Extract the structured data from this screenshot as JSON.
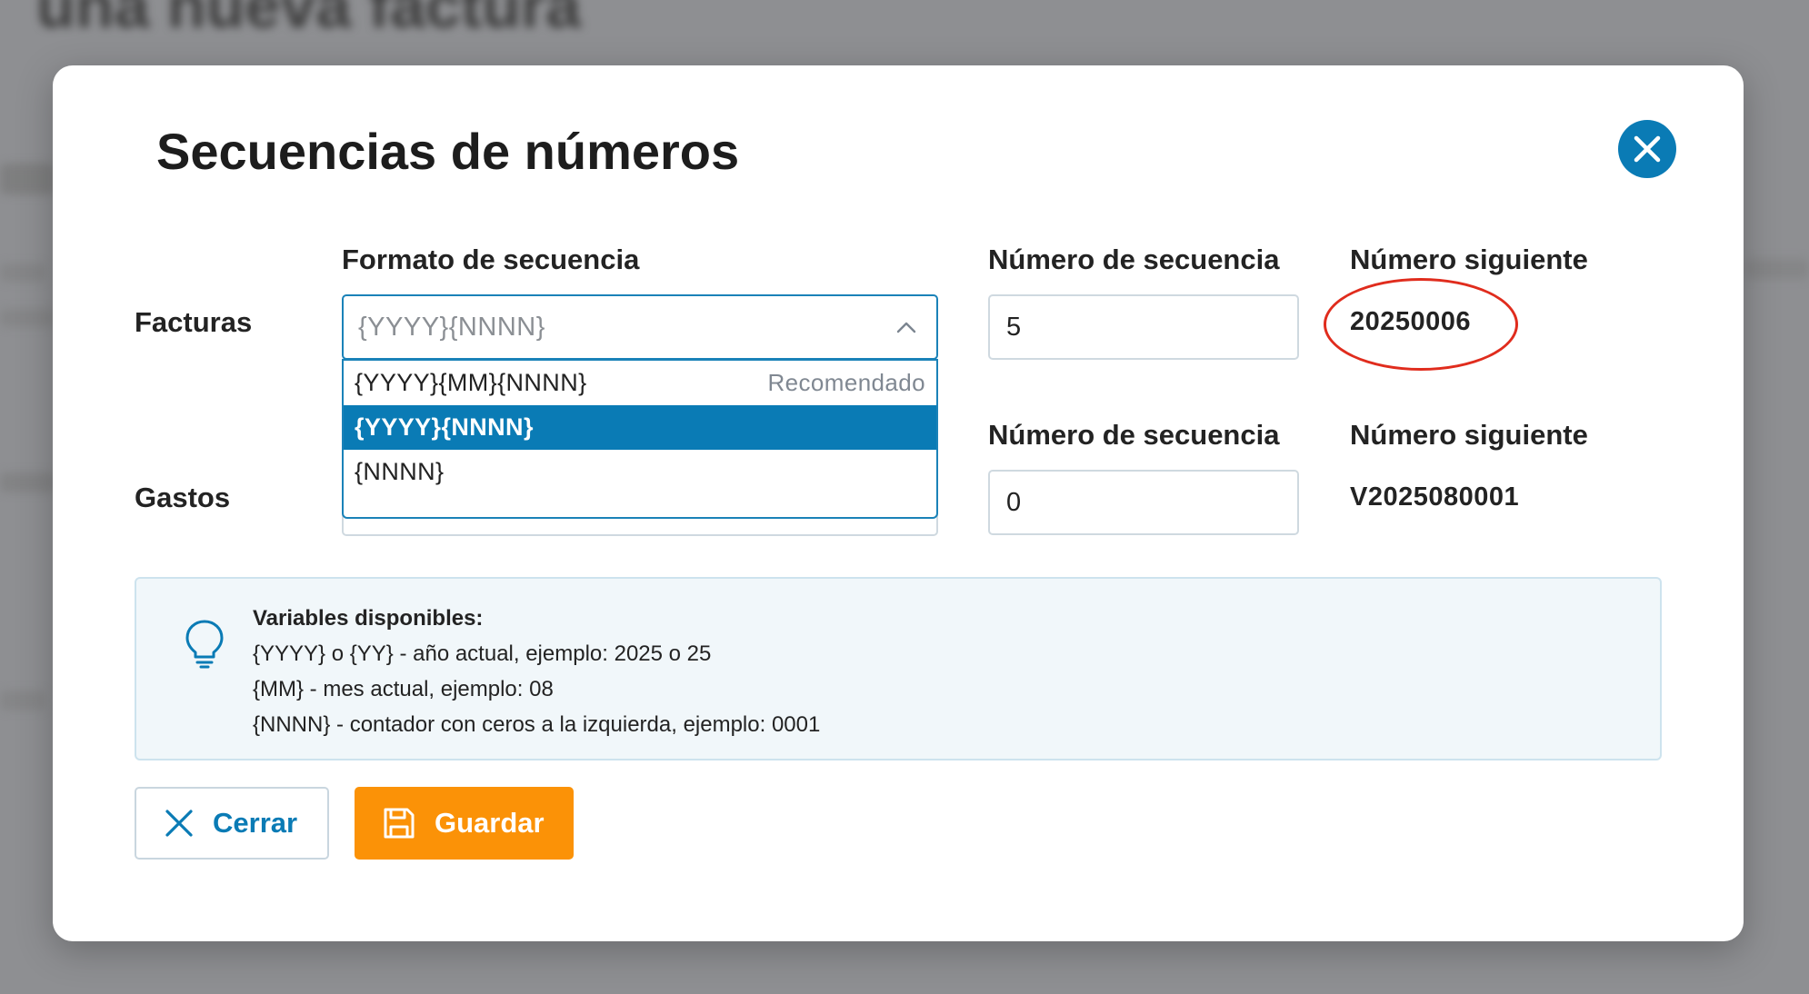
{
  "background": {
    "title": "una nueva factura",
    "color_overlay": "#8e8f92"
  },
  "modal": {
    "title": "Secuencias de números",
    "close_icon": "close-icon",
    "columns": {
      "format": "Formato de secuencia",
      "seq_number": "Número de secuencia",
      "next_number": "Número siguiente"
    },
    "rows": [
      {
        "label": "Facturas",
        "format_value": "{YYYY}{NNNN}",
        "seq_number_label": "Número de secuencia",
        "seq_number": "5",
        "next_number_label": "Número siguiente",
        "next_number": "20250006"
      },
      {
        "label": "Gastos",
        "seq_number_label": "Número de secuencia",
        "seq_number": "0",
        "next_number_label": "Número siguiente",
        "next_number": "V2025080001"
      }
    ],
    "dropdown": {
      "options": [
        {
          "label": "{YYYY}{MM}{NNNN}",
          "hint": "Recomendado"
        },
        {
          "label": "{YYYY}{NNNN}",
          "hint": ""
        },
        {
          "label": "{NNNN}",
          "hint": ""
        }
      ],
      "selected_index": 1
    },
    "info": {
      "icon": "lightbulb-icon",
      "heading": "Variables disponibles:",
      "lines": [
        "{YYYY} o {YY} - año actual, ejemplo: 2025 o 25",
        "{MM} - mes actual, ejemplo: 08",
        "{NNNN} - contador con ceros a la izquierda, ejemplo: 0001"
      ]
    },
    "buttons": {
      "close": "Cerrar",
      "save": "Guardar"
    }
  },
  "colors": {
    "accent": "#0a7bb5",
    "save_button": "#fb9207",
    "annotation": "#e02c1d"
  }
}
